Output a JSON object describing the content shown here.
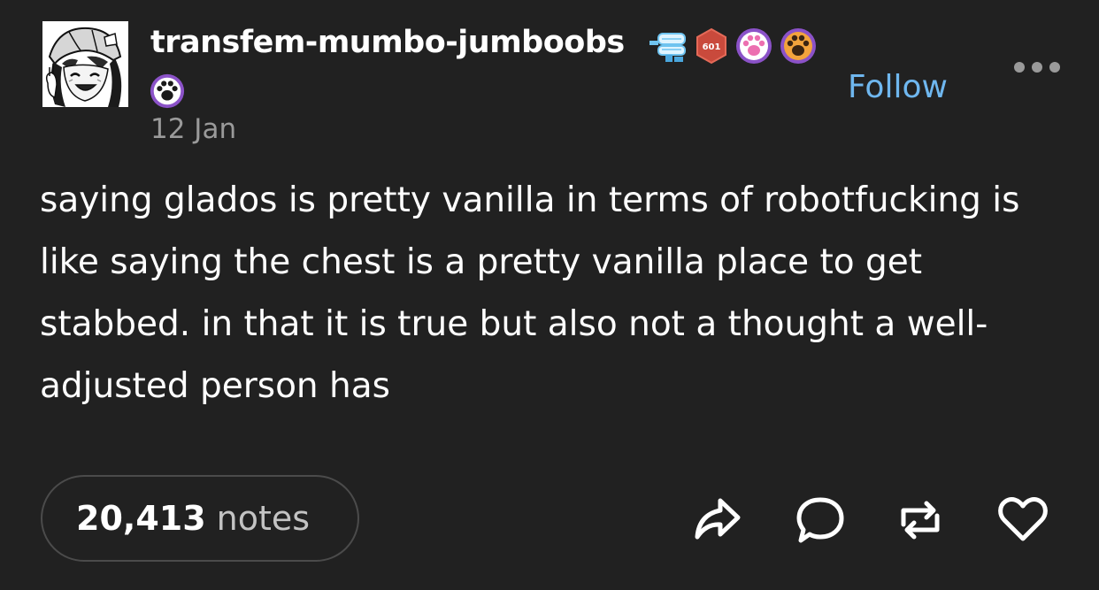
{
  "post": {
    "username": "transfem-mumbo-jumboobs",
    "date": "12 Jan",
    "follow_label": "Follow",
    "badge_number": "601",
    "text": "saying glados is pretty vanilla in terms of robotfucking is like saying the chest is a pretty vanilla place to get stabbed. in that it is true but also not a thought a well-adjusted person has",
    "notes_count": "20,413",
    "notes_label": "notes"
  },
  "icons": {
    "more": "more-horizontal-icon",
    "share": "share-arrow-icon",
    "reply": "reply-bubble-icon",
    "reblog": "reblog-icon",
    "like": "heart-icon"
  },
  "colors": {
    "background": "#212121",
    "text": "#ffffff",
    "muted": "#9a9a9a",
    "follow": "#6fb7ef",
    "notes_border": "#4b4b4b"
  }
}
